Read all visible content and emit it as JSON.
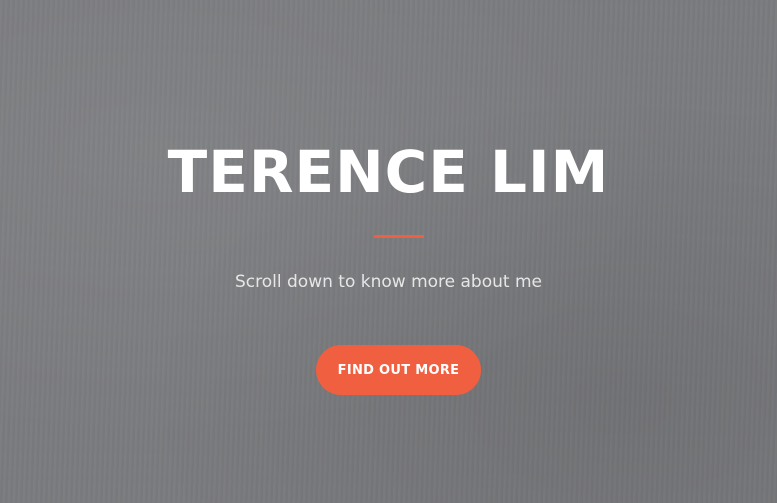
{
  "hero": {
    "title": "TERENCE LIM",
    "subtitle": "Scroll down to know more about me",
    "cta_label": "FIND OUT MORE"
  },
  "colors": {
    "background": "#7a7b7e",
    "accent": "#f05f40",
    "title_text": "#ffffff",
    "subtitle_text": "#e6e6e6"
  }
}
